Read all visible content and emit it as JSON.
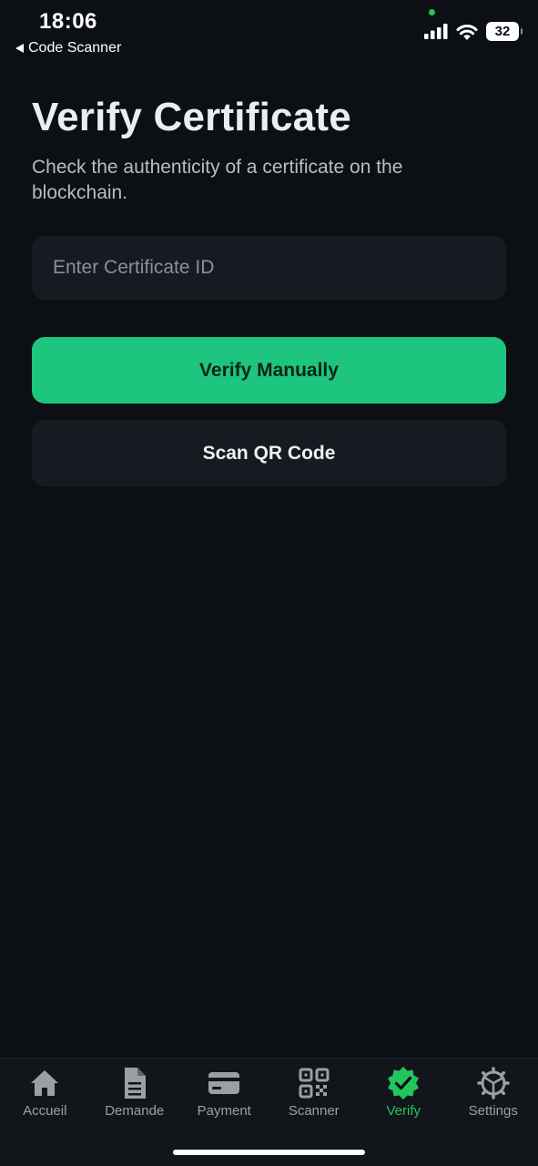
{
  "status_bar": {
    "time": "18:06",
    "back_label": "Code Scanner",
    "battery_level": "32",
    "icons": [
      "signal-icon",
      "wifi-icon",
      "battery-icon"
    ]
  },
  "header": {
    "title": "Verify Certificate",
    "subtitle": "Check the authenticity of a certificate on the blockchain."
  },
  "form": {
    "certificate_input": {
      "placeholder": "Enter Certificate ID",
      "value": ""
    },
    "verify_button_label": "Verify Manually",
    "scan_button_label": "Scan QR Code"
  },
  "tab_bar": {
    "active_tab": "Verify",
    "tabs": [
      {
        "label": "Accueil",
        "icon": "home-icon"
      },
      {
        "label": "Demande",
        "icon": "document-icon"
      },
      {
        "label": "Payment",
        "icon": "credit-card-icon"
      },
      {
        "label": "Scanner",
        "icon": "qr-code-icon"
      },
      {
        "label": "Verify",
        "icon": "verified-badge-icon"
      },
      {
        "label": "Settings",
        "icon": "gear-icon"
      }
    ]
  },
  "colors": {
    "background": "#0c1014",
    "accent": "#1ec57f",
    "surface": "#161b21",
    "tab_inactive": "#9aa0a6"
  }
}
